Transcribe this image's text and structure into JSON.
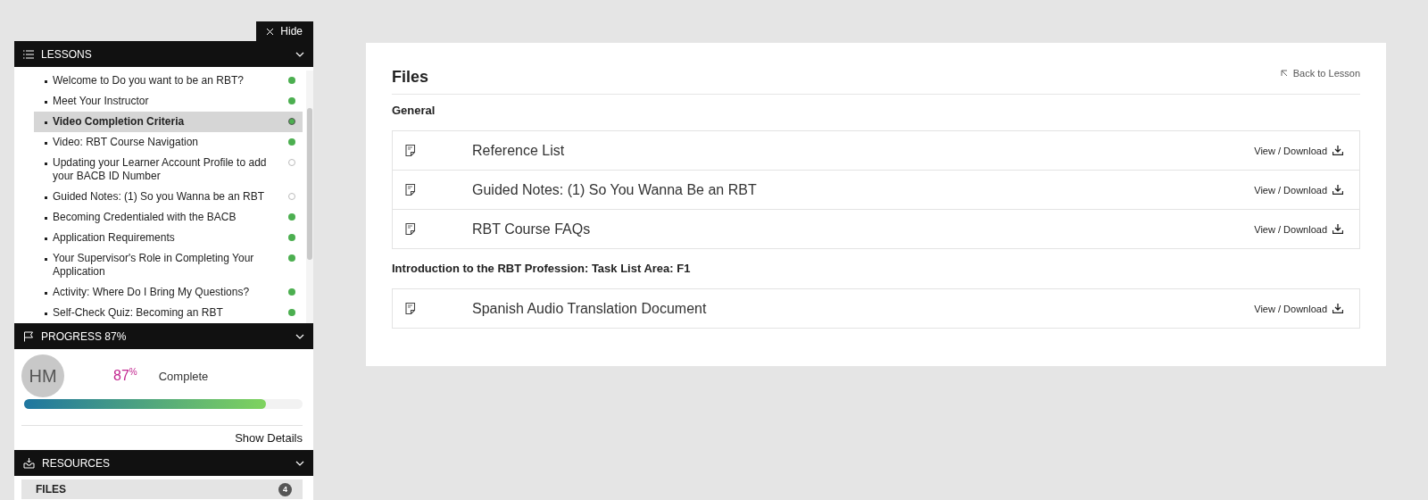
{
  "sidebar": {
    "hide_button": "Hide",
    "lessons": {
      "title": "LESSONS",
      "expanded": true,
      "items": [
        {
          "label": "Welcome to Do you want to be an RBT?",
          "completed": true,
          "selected": false
        },
        {
          "label": "Meet Your Instructor",
          "completed": true,
          "selected": false
        },
        {
          "label": "Video Completion Criteria",
          "completed": true,
          "selected": true
        },
        {
          "label": "Video: RBT Course Navigation",
          "completed": true,
          "selected": false
        },
        {
          "label": "Updating your Learner Account Profile to add your BACB ID Number",
          "completed": false,
          "selected": false
        },
        {
          "label": "Guided Notes: (1) So you Wanna be an RBT",
          "completed": false,
          "selected": false
        },
        {
          "label": "Becoming Credentialed with the BACB",
          "completed": true,
          "selected": false
        },
        {
          "label": "Application Requirements",
          "completed": true,
          "selected": false
        },
        {
          "label": "Your Supervisor's Role in Completing Your Application",
          "completed": true,
          "selected": false
        },
        {
          "label": "Activity: Where Do I Bring My Questions?",
          "completed": true,
          "selected": false
        },
        {
          "label": "Self-Check Quiz: Becoming an RBT",
          "completed": true,
          "selected": false
        }
      ]
    },
    "progress": {
      "title": "PROGRESS 87%",
      "avatar": "HM",
      "percent": "87$^{%}$",
      "status": "Complete",
      "level": 0.87,
      "details_link": "Show Details"
    },
    "resources": {
      "title": "RESOURCES",
      "items": [
        {
          "label": "FILES",
          "count": "4",
          "selected": true
        }
      ]
    }
  },
  "files": {
    "title": "Files",
    "back_link": "Back to Lesson",
    "groups": [
      {
        "title": "General",
        "files": [
          {
            "name": "Reference List",
            "action": "View / Download"
          },
          {
            "name": "Guided Notes: (1) So You Wanna Be an RBT",
            "action": "View / Download"
          },
          {
            "name": "RBT Course FAQs",
            "action": "View / Download"
          }
        ]
      },
      {
        "title": "Introduction to the RBT Profession: Task List Area: F1",
        "files": [
          {
            "name": "Spanish Audio Translation Document",
            "action": "View / Download"
          }
        ]
      }
    ]
  }
}
